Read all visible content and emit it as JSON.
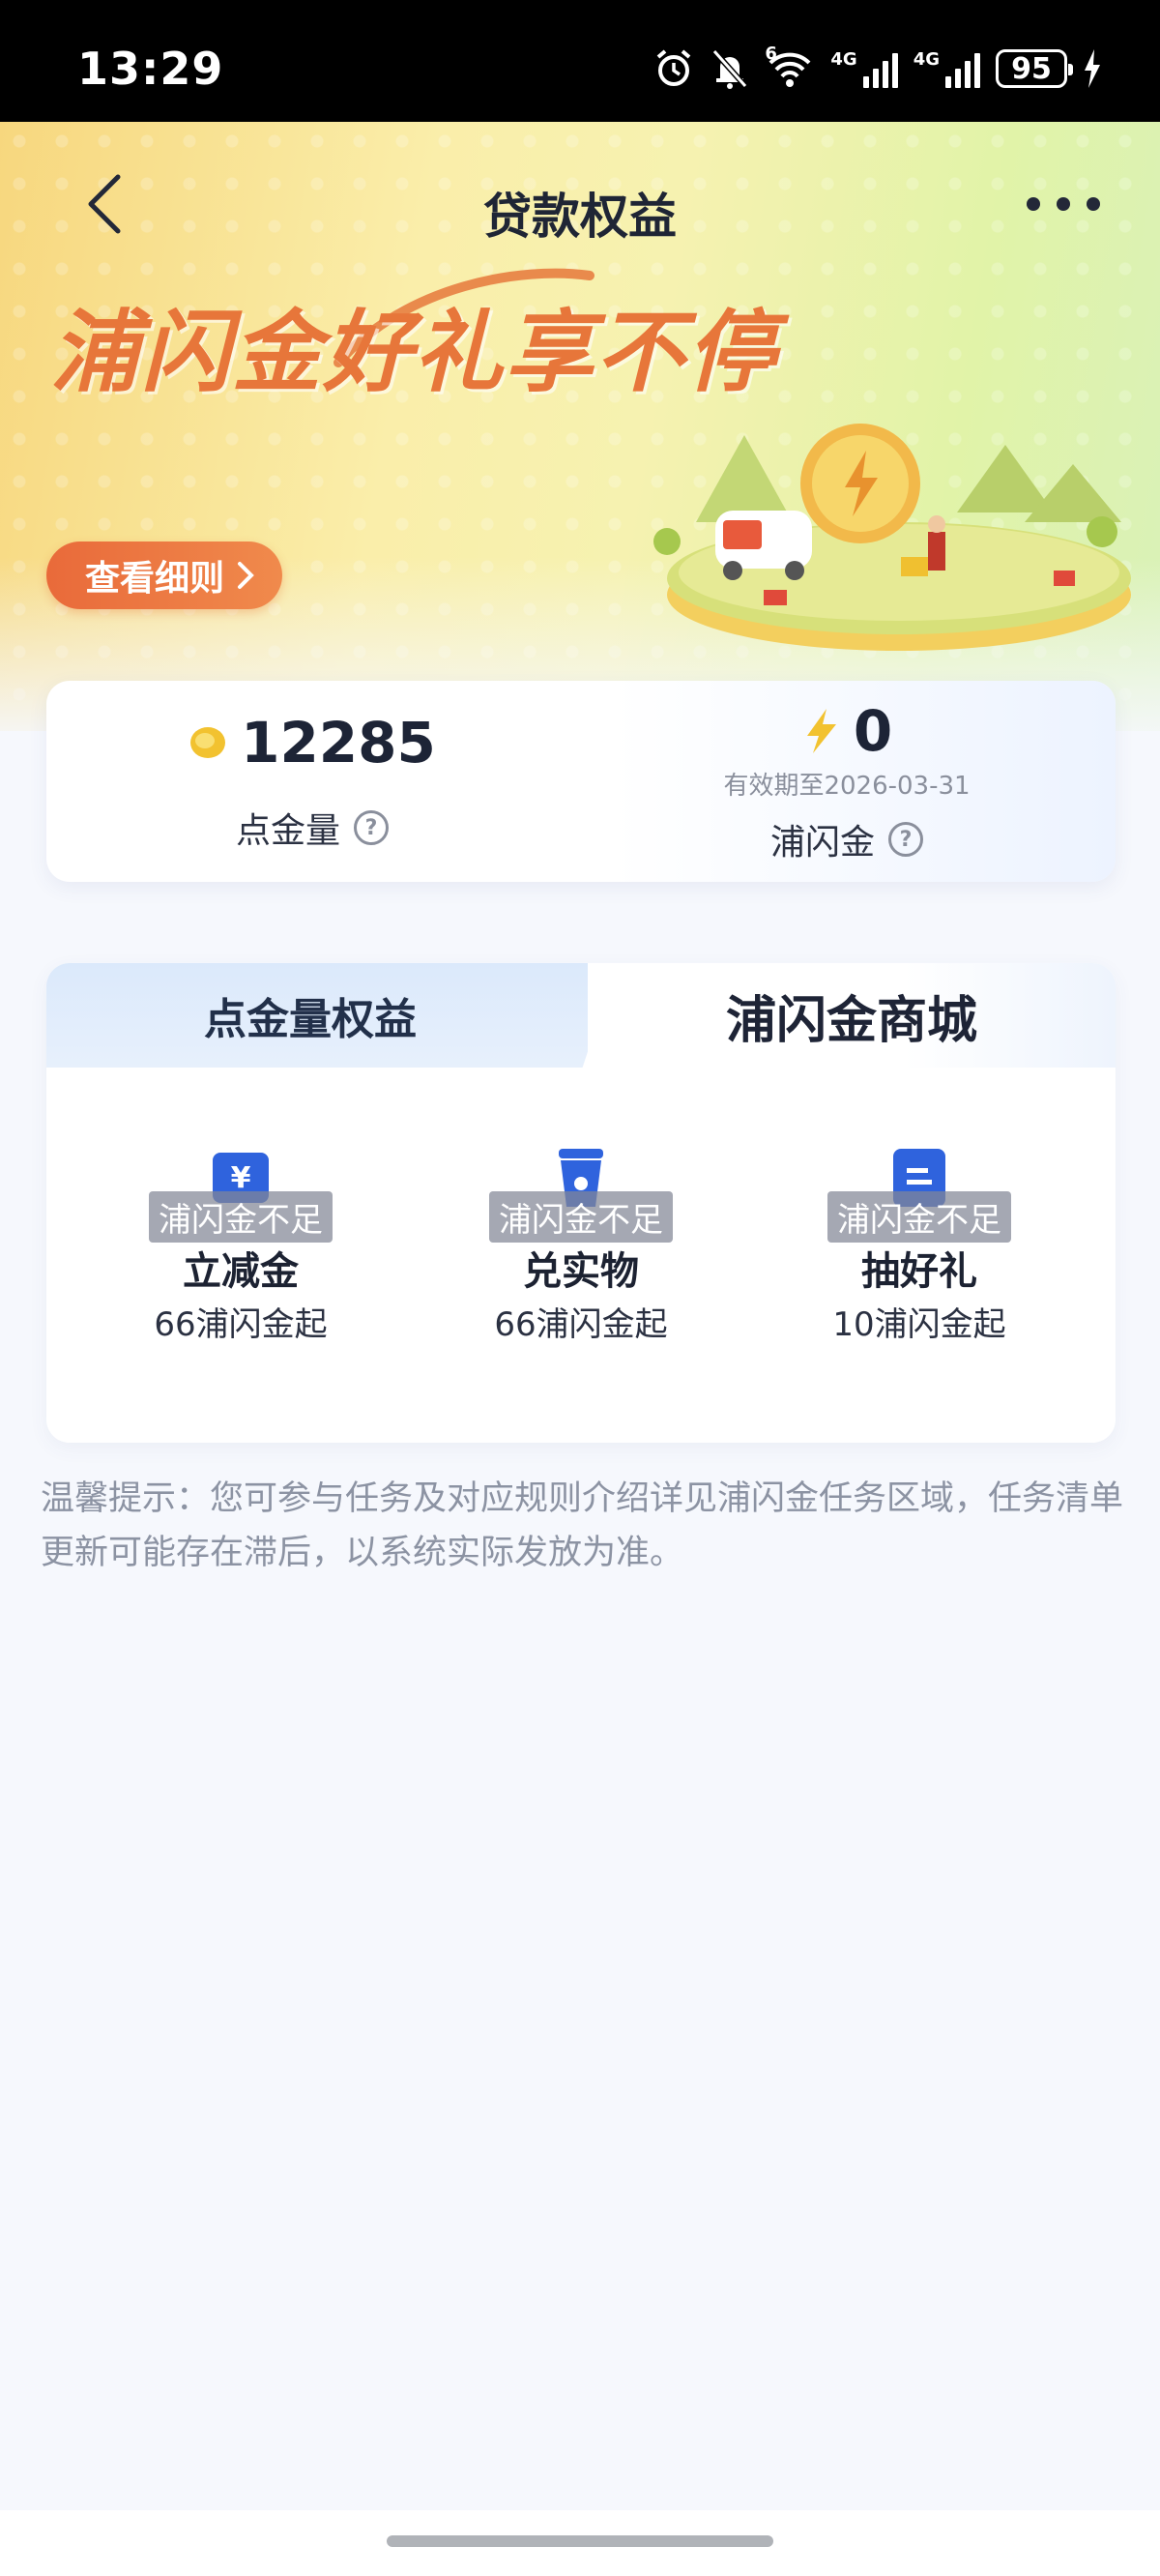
{
  "status_bar": {
    "time": "13:29",
    "battery": "95",
    "signal_labels": [
      "4G",
      "4G"
    ],
    "wifi_label": "6"
  },
  "header": {
    "title": "贷款权益"
  },
  "banner": {
    "headline": "浦闪金好礼享不停",
    "rules_button": "查看细则"
  },
  "points": {
    "dianjin_value": "12285",
    "dianjin_label": "点金量",
    "pushan_value": "0",
    "pushan_expiry": "有效期至2026-03-31",
    "pushan_label": "浦闪金",
    "help_glyph": "?"
  },
  "tabs": [
    {
      "label": "点金量权益",
      "active": false
    },
    {
      "label": "浦闪金商城",
      "active": true
    }
  ],
  "store_items": [
    {
      "badge": "浦闪金不足",
      "name": "立减金",
      "price": "66浦闪金起",
      "icon": "voucher-icon"
    },
    {
      "badge": "浦闪金不足",
      "name": "兑实物",
      "price": "66浦闪金起",
      "icon": "cup-icon"
    },
    {
      "badge": "浦闪金不足",
      "name": "抽好礼",
      "price": "10浦闪金起",
      "icon": "box-icon"
    }
  ],
  "tips": "温馨提示：您可参与任务及对应规则介绍详见浦闪金任务区域，任务清单更新可能存在滞后，以系统实际发放为准。",
  "colors": {
    "accent_orange": "#e96a3a",
    "brand_blue": "#2d5fd8",
    "gold": "#f2c230"
  }
}
